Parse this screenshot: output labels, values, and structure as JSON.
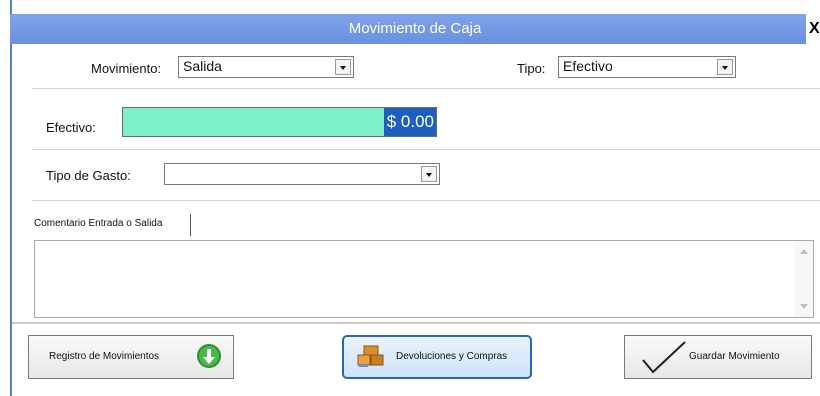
{
  "window": {
    "title": "Movimiento de Caja",
    "close_label": "X"
  },
  "movimiento": {
    "label": "Movimiento:",
    "value": "Salida"
  },
  "tipo": {
    "label": "Tipo:",
    "value": "Efectivo"
  },
  "efectivo": {
    "label": "Efectivo:",
    "value": "$ 0.00"
  },
  "tipo_gasto": {
    "label": "Tipo de Gasto:",
    "value": ""
  },
  "comentario": {
    "tab_label": "Comentario Entrada o Salida",
    "value": ""
  },
  "buttons": {
    "registro": "Registro de Movimientos",
    "devoluciones": "Devoluciones y Compras",
    "guardar": "Guardar Movimiento"
  },
  "colors": {
    "titlebar": "#6a90e0",
    "money_field": "#7ef0c8",
    "selection": "#1d5fbf",
    "focus_border": "#2e64b4"
  },
  "icons": {
    "registro": "download-arrow-icon",
    "devoluciones": "boxes-icon",
    "guardar": "checkmark-icon"
  }
}
